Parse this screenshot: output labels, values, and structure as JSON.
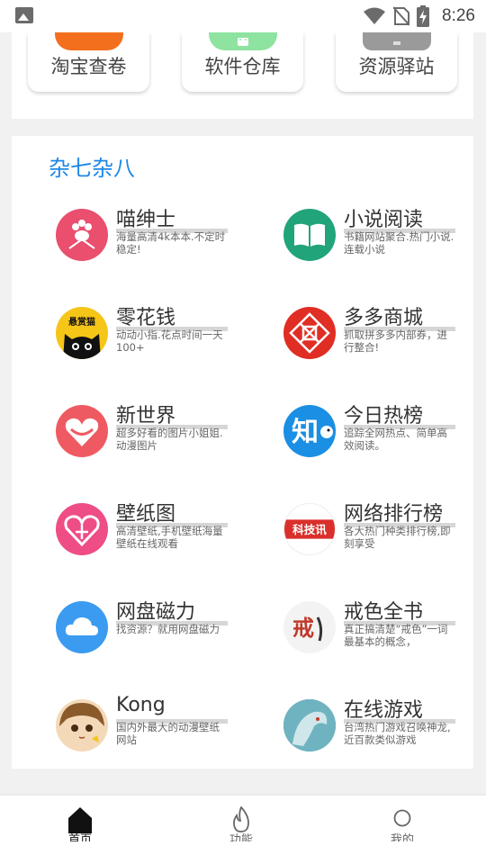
{
  "status_bar": {
    "time": "8:26",
    "icons": [
      "image-icon",
      "wifi-icon",
      "no-sim-icon",
      "battery-charging-icon"
    ]
  },
  "tools": [
    {
      "label": "淘宝查卷",
      "icon": "taobao-icon",
      "color": "#f36f1e"
    },
    {
      "label": "软件仓库",
      "icon": "android-icon",
      "color": "#8fe3a0"
    },
    {
      "label": "资源驿站",
      "icon": "resource-icon",
      "color": "#9a9a9a"
    }
  ],
  "misc": {
    "title": "杂七杂八",
    "items": [
      {
        "name": "喵绅士",
        "desc": "海量高清4k本本.不定时稳定!",
        "icon": "paw-icon",
        "color": "#ea4f6e"
      },
      {
        "name": "小说阅读",
        "desc": "书籍网站聚合.热门小说.连载小说",
        "icon": "book-icon",
        "color": "#22a47a"
      },
      {
        "name": "零花钱",
        "desc": "动动小指.花点时间一天100+",
        "icon": "cat-icon",
        "color": "#f5c518",
        "badge": "悬赏猫"
      },
      {
        "name": "多多商城",
        "desc": "抓取拼多多内部券，进行整合!",
        "icon": "shop-icon",
        "color": "#e02e24"
      },
      {
        "name": "新世界",
        "desc": "超多好看的图片小姐姐.动漫图片",
        "icon": "heart-icon",
        "color": "#ef5a62"
      },
      {
        "name": "今日热榜",
        "desc": "追踪全网热点、简单高效阅读。",
        "icon": "zhihu-icon",
        "color": "#1a8fe3",
        "badge": "知"
      },
      {
        "name": "壁纸图",
        "desc": "高清壁纸,手机壁纸海量壁纸在线观看",
        "icon": "wallpaper-heart-icon",
        "color": "#ee4d86"
      },
      {
        "name": "网络排行榜",
        "desc": "各大热门种类排行榜,即刻享受",
        "icon": "ranking-icon",
        "color": "#d9302c",
        "badge": "科技讯"
      },
      {
        "name": "网盘磁力",
        "desc": "找资源？就用网盘磁力",
        "icon": "cloud-icon",
        "color": "#3b9bf0"
      },
      {
        "name": "戒色全书",
        "desc": "真正搞清楚“戒色”一词最基本的概念，",
        "icon": "calligraphy-icon",
        "color": "#c0392b",
        "badge": "戒"
      },
      {
        "name": "Kong",
        "desc": "国内外最大的动漫壁纸网站",
        "icon": "anime-avatar-icon",
        "color": "#8b5a2b"
      },
      {
        "name": "在线游戏",
        "desc": "台湾热门游戏召唤神龙,近百款类似游戏",
        "icon": "dragon-icon",
        "color": "#3a8fa0"
      }
    ]
  },
  "nav": [
    {
      "label": "首页",
      "icon": "home-icon"
    },
    {
      "label": "功能",
      "icon": "fire-icon"
    },
    {
      "label": "我的",
      "icon": "user-icon"
    }
  ]
}
